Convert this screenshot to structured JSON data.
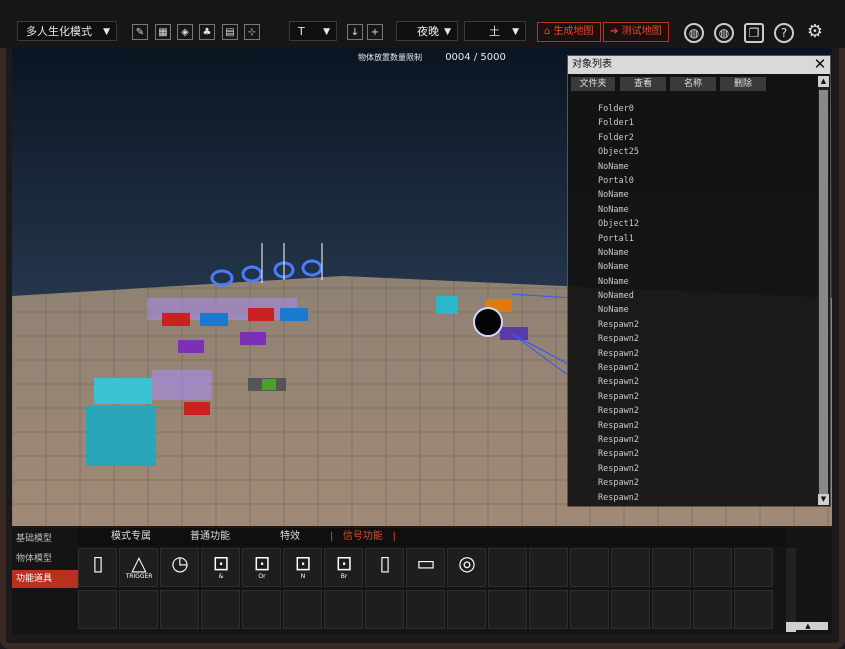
{
  "toolbar": {
    "mode_select": "多人生化模式",
    "tool_icons": [
      "brush-icon",
      "grid-icon",
      "object-icon",
      "shape-icon",
      "layer-icon",
      "graph-icon"
    ],
    "t_select": "T",
    "move_down_label": "↓",
    "add_label": "+",
    "time_select": "夜晚",
    "ground_select": "土",
    "generate_map_label": "生成地图",
    "test_map_label": "测试地图",
    "right_icons": [
      "map-add-icon",
      "map-add-icon-2",
      "book-icon",
      "help-icon",
      "settings-icon"
    ]
  },
  "viewport": {
    "counter_label": "物体放置数量限制",
    "counter_value": "0004 / 5000"
  },
  "object_panel": {
    "title": "对象列表",
    "columns": [
      "文件夹",
      "查看",
      "名称",
      "删除"
    ],
    "items": [
      "Folder0",
      "Folder1",
      "Folder2",
      "Object25",
      "NoName",
      "Portal0",
      "NoName",
      "NoName",
      "Object12",
      "Portal1",
      "NoName",
      "NoName",
      "NoName",
      "NoNamed",
      "NoName",
      "Respawn2",
      "Respawn2",
      "Respawn2",
      "Respawn2",
      "Respawn2",
      "Respawn2",
      "Respawn2",
      "Respawn2",
      "Respawn2",
      "Respawn2",
      "Respawn2",
      "Respawn2",
      "Respawn2"
    ]
  },
  "bottom": {
    "side_tabs": [
      {
        "label": "基础模型",
        "active": false
      },
      {
        "label": "物体模型",
        "active": false
      },
      {
        "label": "功能道具",
        "active": true
      }
    ],
    "category_tabs": [
      {
        "label": "模式专属",
        "active": false
      },
      {
        "label": "普通功能",
        "active": false
      },
      {
        "label": "特效",
        "active": false
      },
      {
        "label": "信号功能",
        "active": true
      }
    ],
    "items": [
      {
        "icon": "switch-icon",
        "text": ""
      },
      {
        "icon": "trigger-icon",
        "text": "TRIGGER"
      },
      {
        "icon": "clock-icon",
        "text": ""
      },
      {
        "icon": "and-gate-icon",
        "text": "&"
      },
      {
        "icon": "or-gate-icon",
        "text": "Or"
      },
      {
        "icon": "not-gate-icon",
        "text": "N"
      },
      {
        "icon": "branch-gate-icon",
        "text": "Br"
      },
      {
        "icon": "door-icon",
        "text": ""
      },
      {
        "icon": "message-icon",
        "text": ""
      },
      {
        "icon": "portal-icon",
        "text": ""
      }
    ]
  }
}
